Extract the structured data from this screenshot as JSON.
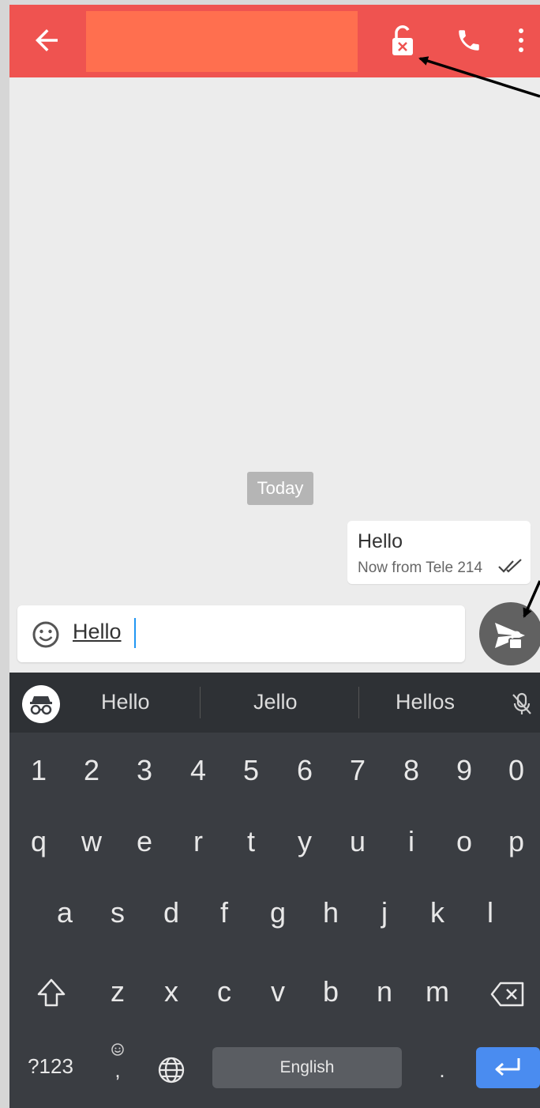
{
  "app": {
    "title_redacted": "",
    "icons": [
      "arrow-back-icon",
      "unlock-x-icon",
      "phone-icon",
      "more-vert-icon"
    ],
    "accent_color": "#ef5350"
  },
  "chat": {
    "date_chip": "Today",
    "messages": [
      {
        "text": "Hello",
        "meta": "Now from Tele 214",
        "status": "double-check"
      }
    ]
  },
  "composer": {
    "emoji_icon": "smiley-icon",
    "input_value": "Hello",
    "send_icon": "send-lock-icon"
  },
  "keyboard": {
    "suggestions": [
      "Hello",
      "Jello",
      "Hellos"
    ],
    "row_numbers": [
      "1",
      "2",
      "3",
      "4",
      "5",
      "6",
      "7",
      "8",
      "9",
      "0"
    ],
    "row1": [
      "q",
      "w",
      "e",
      "r",
      "t",
      "y",
      "u",
      "i",
      "o",
      "p"
    ],
    "row2": [
      "a",
      "s",
      "d",
      "f",
      "g",
      "h",
      "j",
      "k",
      "l"
    ],
    "row3": [
      "z",
      "x",
      "c",
      "v",
      "b",
      "n",
      "m"
    ],
    "bottom": {
      "symbols": "?123",
      "comma": ",",
      "space": "English",
      "period": "."
    },
    "enter_color": "#4a8cf0"
  }
}
